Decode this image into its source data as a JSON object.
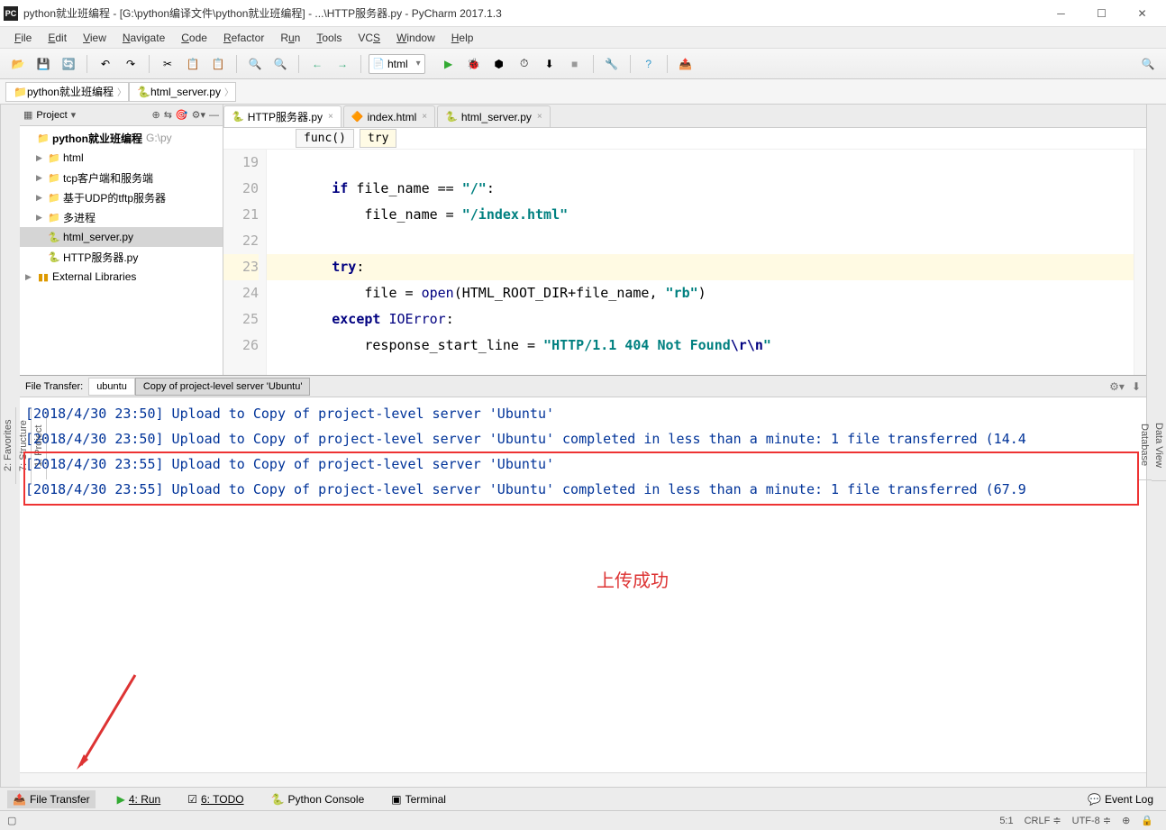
{
  "window": {
    "title": "python就业班编程 - [G:\\python编译文件\\python就业班编程] - ...\\HTTP服务器.py - PyCharm 2017.1.3"
  },
  "menu": [
    "File",
    "Edit",
    "View",
    "Navigate",
    "Code",
    "Refactor",
    "Run",
    "Tools",
    "VCS",
    "Window",
    "Help"
  ],
  "toolbar": {
    "combo": "html"
  },
  "breadcrumb": [
    "python就业班编程",
    "html_server.py"
  ],
  "project": {
    "header": "Project",
    "tree": {
      "root": "python就业班编程",
      "root_hint": "G:\\py",
      "folders": [
        "html",
        "tcp客户端和服务端",
        "基于UDP的tftp服务器",
        "多进程"
      ],
      "files": [
        "html_server.py",
        "HTTP服务器.py"
      ],
      "external": "External Libraries"
    }
  },
  "editor": {
    "tabs": [
      {
        "name": "HTTP服务器.py",
        "active": true
      },
      {
        "name": "index.html",
        "active": false
      },
      {
        "name": "html_server.py",
        "active": false
      }
    ],
    "crumbs": [
      "func()",
      "try"
    ],
    "lines": [
      {
        "n": 19,
        "t": ""
      },
      {
        "n": 20,
        "t": "        if file_name == \"/\":",
        "tokens": [
          [
            "        ",
            ""
          ],
          [
            "if",
            "kw"
          ],
          [
            " file_name == ",
            ""
          ],
          [
            "\"/\"",
            "str"
          ],
          [
            ":",
            ""
          ]
        ]
      },
      {
        "n": 21,
        "t": "            file_name = \"/index.html\"",
        "tokens": [
          [
            "            file_name = ",
            ""
          ],
          [
            "\"/index.html\"",
            "str"
          ]
        ]
      },
      {
        "n": 22,
        "t": ""
      },
      {
        "n": 23,
        "hl": true,
        "t": "        try:",
        "tokens": [
          [
            "        ",
            ""
          ],
          [
            "try",
            "kw"
          ],
          [
            ":",
            ""
          ]
        ]
      },
      {
        "n": 24,
        "t": "            file = open(HTML_ROOT_DIR+file_name, \"rb\")",
        "tokens": [
          [
            "            file = ",
            ""
          ],
          [
            "open",
            "fn"
          ],
          [
            "(HTML_ROOT_DIR+file_name, ",
            ""
          ],
          [
            "\"rb\"",
            "str"
          ],
          [
            ")",
            ""
          ]
        ]
      },
      {
        "n": 25,
        "t": "        except IOError:",
        "tokens": [
          [
            "        ",
            ""
          ],
          [
            "except",
            "kw"
          ],
          [
            " ",
            ""
          ],
          [
            "IOError",
            "fn"
          ],
          [
            ":",
            ""
          ]
        ]
      },
      {
        "n": 26,
        "t": "            response_start_line = \"HTTP/1.1 404 Not Found\\r\\n\"",
        "tokens": [
          [
            "            response_start_line = ",
            ""
          ],
          [
            "\"HTTP/1.1 404 Not Found",
            "str"
          ],
          [
            "\\r\\n",
            "esc"
          ],
          [
            "\"",
            "str"
          ]
        ]
      }
    ]
  },
  "file_transfer": {
    "label": "File Transfer:",
    "subtabs": [
      "ubuntu",
      "Copy of project-level server 'Ubuntu'"
    ],
    "active_sub": 1,
    "log": [
      "[2018/4/30 23:50] Upload to Copy of project-level server 'Ubuntu'",
      "[2018/4/30 23:50] Upload to Copy of project-level server 'Ubuntu' completed in less than a minute: 1 file transferred (14.4",
      "[2018/4/30 23:55] Upload to Copy of project-level server 'Ubuntu'",
      "[2018/4/30 23:55] Upload to Copy of project-level server 'Ubuntu' completed in less than a minute: 1 file transferred (67.9"
    ],
    "annotation": "上传成功"
  },
  "tool_tabs": {
    "file_transfer": "File Transfer",
    "run": "4: Run",
    "todo": "6: TODO",
    "pyconsole": "Python Console",
    "terminal": "Terminal",
    "event_log": "Event Log"
  },
  "side_left": [
    "1: Project",
    "7: Structure",
    "2: Favorites"
  ],
  "side_right": [
    "Data View",
    "Database"
  ],
  "status": {
    "pos": "5:1",
    "crlf": "CRLF",
    "enc": "UTF-8"
  }
}
